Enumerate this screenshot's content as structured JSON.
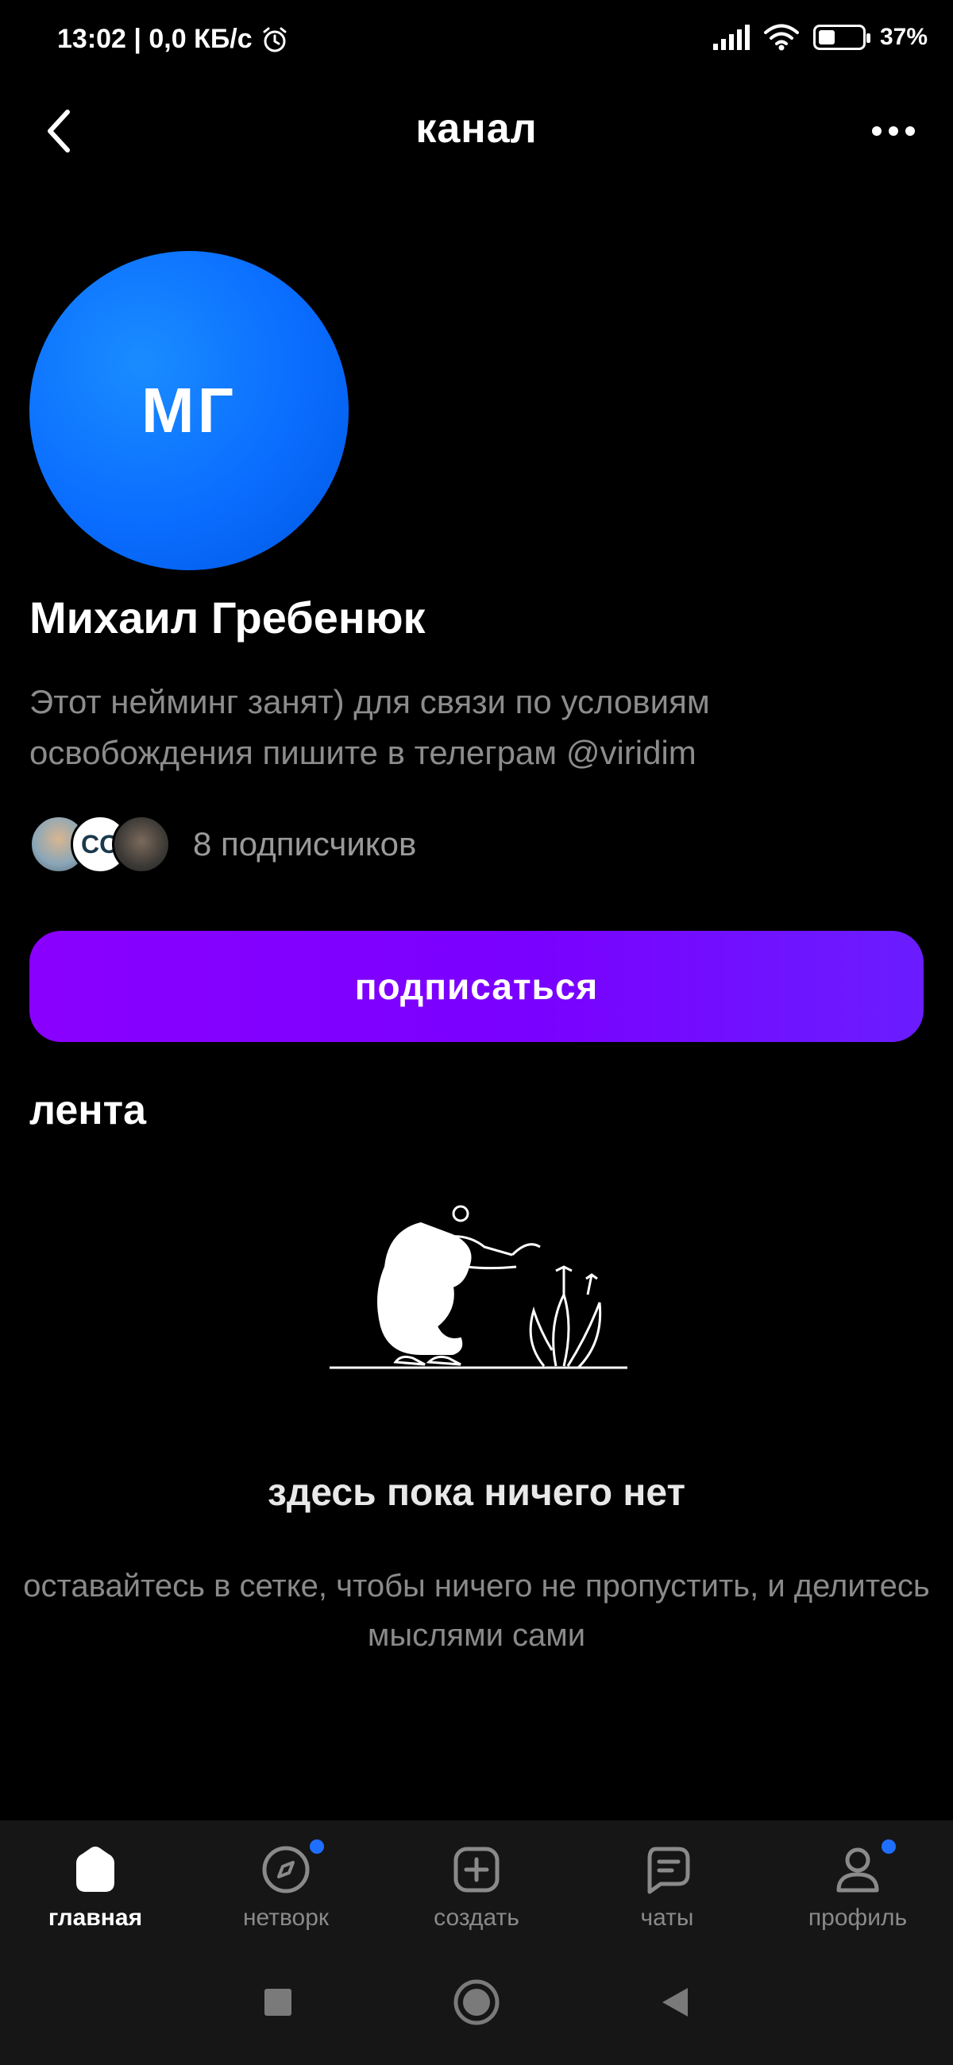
{
  "status_bar": {
    "time_and_speed": "13:02 | 0,0 КБ/с",
    "battery_percent": "37%",
    "battery_level": 0.37
  },
  "header": {
    "title": "канал"
  },
  "channel": {
    "avatar_initials": "МГ",
    "name": "Михаил Гребенюк",
    "description": "Этот нейминг занят) для связи по условиям освобождения пишите в телеграм @viridim",
    "subscriber_avatar_text": "CO",
    "subscribers_label": "8 подписчиков",
    "subscribe_label": "подписаться"
  },
  "feed": {
    "title": "лента",
    "empty_title": "здесь пока ничего нет",
    "empty_subtitle": "оставайтесь в сетке, чтобы ничего не пропустить, и делитесь мыслями сами"
  },
  "bottom_nav": {
    "items": [
      {
        "label": "главная",
        "icon": "home-icon",
        "active": true
      },
      {
        "label": "нетворк",
        "icon": "compass-icon",
        "badge": true
      },
      {
        "label": "создать",
        "icon": "plus-square-icon"
      },
      {
        "label": "чаты",
        "icon": "chat-icon"
      },
      {
        "label": "профиль",
        "icon": "profile-icon",
        "badge": true
      }
    ]
  },
  "colors": {
    "background": "#000000",
    "accent_button": "#8000ff",
    "avatar": "#0a6dff",
    "badge": "#1f6fff"
  }
}
